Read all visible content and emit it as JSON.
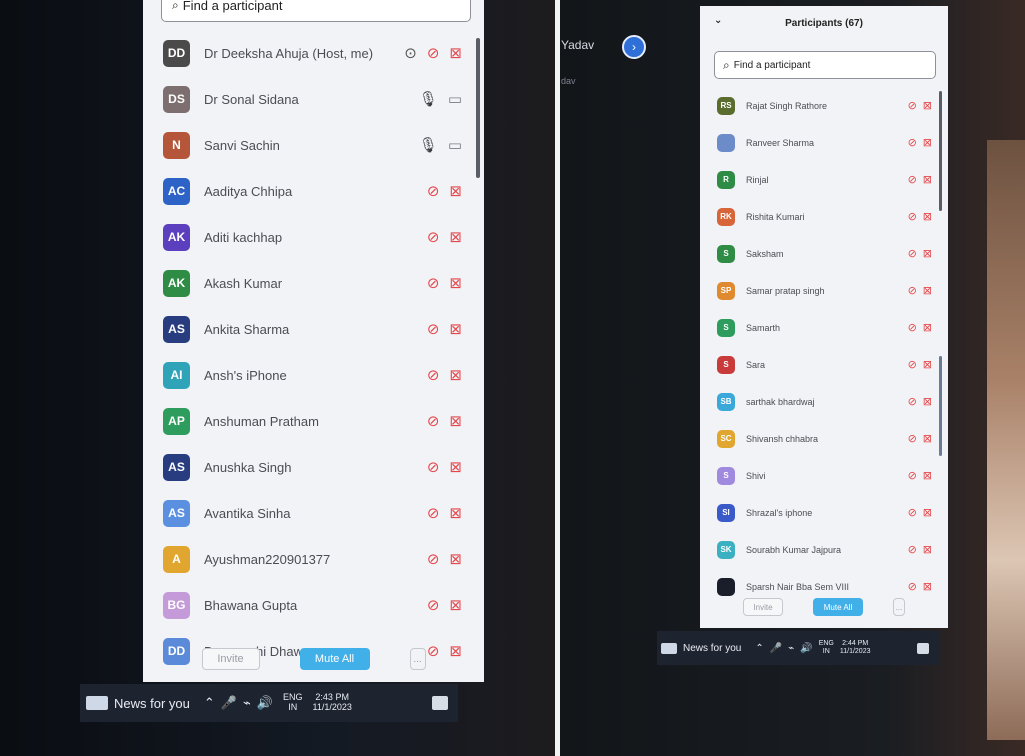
{
  "colors": {
    "host_avatar": "#4a4a4a",
    "ds": "#7d6e70",
    "sanvi": "#b5563a",
    "blue": "#2d62c6",
    "purple": "#5b3fbf",
    "green": "#2e8c45",
    "navy": "#283d80",
    "teal": "#2fa4b8",
    "lightblue": "#5b8fe0",
    "orange": "#e0a62f",
    "mute_button": "#42b0e8"
  },
  "left": {
    "search_placeholder": "Find a participant",
    "participants": [
      {
        "initials": "DD",
        "name": "Dr Deeksha Ahuja (Host, me)",
        "color": "#4a4a4a",
        "mic": "muted",
        "cam": "off",
        "host": true
      },
      {
        "initials": "DS",
        "name": "Dr Sonal Sidana",
        "color": "#7d6e70",
        "mic": "on",
        "cam": "on"
      },
      {
        "initials": "N",
        "name": "Sanvi Sachin",
        "color": "#b5563a",
        "mic": "on",
        "cam": "on"
      },
      {
        "initials": "AC",
        "name": "Aaditya Chhipa",
        "color": "#2d62c6",
        "mic": "muted",
        "cam": "off"
      },
      {
        "initials": "AK",
        "name": "Aditi kachhap",
        "color": "#5b3fbf",
        "mic": "muted",
        "cam": "off"
      },
      {
        "initials": "AK",
        "name": "Akash Kumar",
        "color": "#2e8c45",
        "mic": "muted",
        "cam": "off"
      },
      {
        "initials": "AS",
        "name": "Ankita Sharma",
        "color": "#283d80",
        "mic": "muted",
        "cam": "off"
      },
      {
        "initials": "AI",
        "name": "Ansh's iPhone",
        "color": "#2fa4b8",
        "mic": "muted",
        "cam": "off"
      },
      {
        "initials": "AP",
        "name": "Anshuman Pratham",
        "color": "#2e9c5c",
        "mic": "muted",
        "cam": "off"
      },
      {
        "initials": "AS",
        "name": "Anushka Singh",
        "color": "#283d80",
        "mic": "muted",
        "cam": "off"
      },
      {
        "initials": "AS",
        "name": "Avantika Sinha",
        "color": "#5b8fe0",
        "mic": "muted",
        "cam": "off"
      },
      {
        "initials": "A",
        "name": "Ayushman220901377",
        "color": "#e0a62f",
        "mic": "muted",
        "cam": "off"
      },
      {
        "initials": "BG",
        "name": "Bhawana Gupta",
        "color": "#c49ad8",
        "mic": "muted",
        "cam": "off"
      },
      {
        "initials": "DD",
        "name": "Deepanshi Dhawan",
        "color": "#5a8ad8",
        "mic": "muted",
        "cam": "off"
      }
    ],
    "invite_label": "Invite",
    "mute_all_label": "Mute All",
    "more_label": "...",
    "taskbar": {
      "news": "News for you",
      "lang_top": "ENG",
      "lang_bottom": "IN",
      "time": "2:43 PM",
      "date": "11/1/2023"
    }
  },
  "right": {
    "behind_name": "Yadav",
    "behind_sub": "dav",
    "header_title": "Participants (67)",
    "search_placeholder": "Find a participant",
    "participants": [
      {
        "initials": "RS",
        "name": "Rajat Singh Rathore",
        "color": "#5a6d2f",
        "mic": "muted",
        "cam": "off"
      },
      {
        "initials": "",
        "name": "Ranveer Sharma",
        "color": "#6b8cc9",
        "mic": "muted",
        "cam": "off",
        "photo": true
      },
      {
        "initials": "R",
        "name": "Rinjal",
        "color": "#2e8c45",
        "mic": "muted",
        "cam": "off"
      },
      {
        "initials": "RK",
        "name": "Rishita Kumari",
        "color": "#d8643a",
        "mic": "muted",
        "cam": "off"
      },
      {
        "initials": "S",
        "name": "Saksham",
        "color": "#2e8c45",
        "mic": "muted",
        "cam": "off"
      },
      {
        "initials": "SP",
        "name": "Samar pratap singh",
        "color": "#e08a2f",
        "mic": "muted",
        "cam": "off"
      },
      {
        "initials": "S",
        "name": "Samarth",
        "color": "#2e9c5c",
        "mic": "muted",
        "cam": "off"
      },
      {
        "initials": "S",
        "name": "Sara",
        "color": "#c93a3a",
        "mic": "muted",
        "cam": "off"
      },
      {
        "initials": "SB",
        "name": "sarthak bhardwaj",
        "color": "#3aa8d8",
        "mic": "muted",
        "cam": "off"
      },
      {
        "initials": "SC",
        "name": "Shivansh chhabra",
        "color": "#e0a62f",
        "mic": "muted",
        "cam": "off"
      },
      {
        "initials": "S",
        "name": "Shivi",
        "color": "#a08ae0",
        "mic": "muted",
        "cam": "off"
      },
      {
        "initials": "SI",
        "name": "Shrazal's iphone",
        "color": "#3a5ac9",
        "mic": "muted",
        "cam": "off"
      },
      {
        "initials": "SK",
        "name": "Sourabh Kumar Jajpura",
        "color": "#3ab0c0",
        "mic": "muted",
        "cam": "off"
      },
      {
        "initials": "",
        "name": "Sparsh Nair Bba Sem VIII",
        "color": "#1a1d2a",
        "mic": "muted",
        "cam": "off"
      }
    ],
    "invite_label": "Invite",
    "mute_all_label": "Mute All",
    "more_label": "...",
    "taskbar": {
      "news": "News for you",
      "lang_top": "ENG",
      "lang_bottom": "IN",
      "time": "2:44 PM",
      "date": "11/1/2023"
    }
  }
}
